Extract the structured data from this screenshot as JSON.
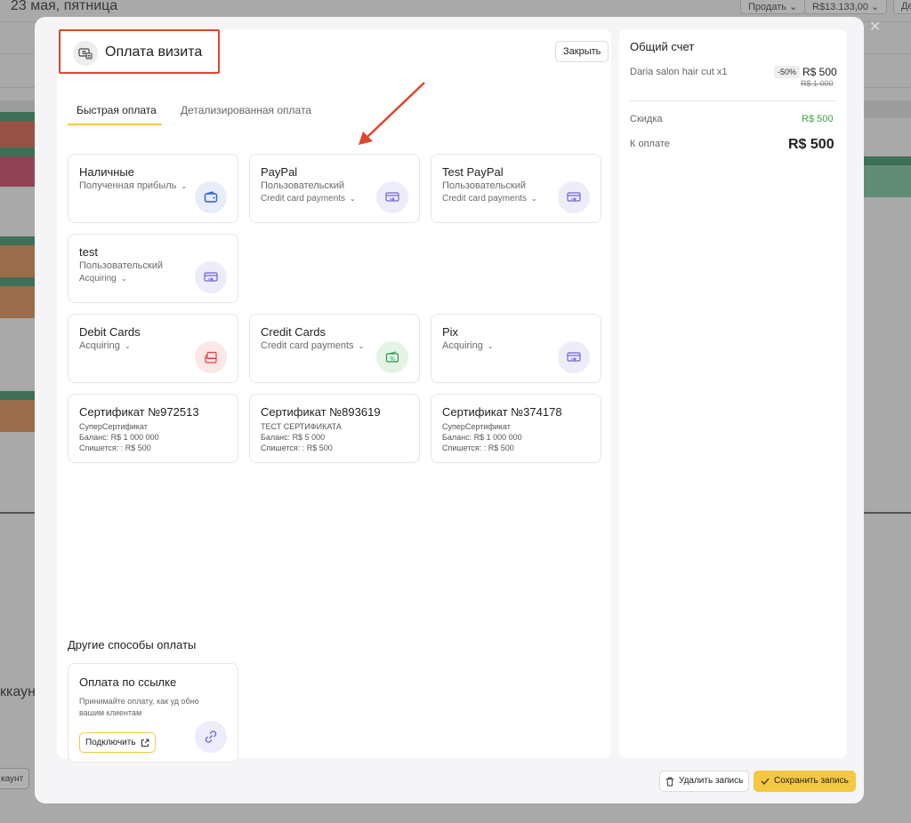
{
  "background": {
    "date": "23 мая, пятница",
    "sell_button": "Продать",
    "balance": "R$13.133,00",
    "right_btn": "Де",
    "left_account_text": "ккаун",
    "left_account_btn": "каунт"
  },
  "modal": {
    "title": "Оплата визита",
    "close_button": "Закрыть",
    "tabs": [
      "Быстрая оплата",
      "Детализированная оплата"
    ],
    "payment_methods": [
      {
        "title": "Наличные",
        "sub": "Полученная прибыль",
        "sub_dropdown": true,
        "sub2": "",
        "icon": "wallet-icon",
        "color": "blue"
      },
      {
        "title": "PayPal",
        "sub": "Пользовательский",
        "sub_dropdown": false,
        "sub2": "Credit card payments",
        "icon": "card-transfer-icon",
        "color": "purple"
      },
      {
        "title": "Test PayPal",
        "sub": "Пользовательский",
        "sub_dropdown": false,
        "sub2": "Credit card payments",
        "icon": "card-transfer-icon",
        "color": "purple"
      },
      {
        "title": "test",
        "sub": "Пользовательский",
        "sub_dropdown": false,
        "sub2": "Acquiring",
        "icon": "card-transfer-icon",
        "color": "purple"
      },
      {
        "title": "Debit Cards",
        "sub": "Acquiring",
        "sub_dropdown": true,
        "sub2": "",
        "icon": "cards-stack-icon",
        "color": "red"
      },
      {
        "title": "Credit Cards",
        "sub": "Credit card payments",
        "sub_dropdown": true,
        "sub2": "",
        "icon": "percent-card-icon",
        "color": "green"
      },
      {
        "title": "Pix",
        "sub": "Acquiring",
        "sub_dropdown": true,
        "sub2": "",
        "icon": "card-transfer-icon",
        "color": "purple"
      }
    ],
    "certificates": [
      {
        "title": "Сертификат №972513",
        "type": "СуперСертификат",
        "balance": "Баланс: R$ 1 000 000",
        "charge": "Спишется: : R$ 500"
      },
      {
        "title": "Сертификат №893619",
        "type": "ТЕСТ СЕРТИФИКАТА",
        "balance": "Баланс: R$ 5 000",
        "charge": "Спишется: : R$ 500"
      },
      {
        "title": "Сертификат №374178",
        "type": "СуперСертификат",
        "balance": "Баланс: R$ 1 000 000",
        "charge": "Спишется: : R$ 500"
      }
    ],
    "other_methods_title": "Другие способы оплаты",
    "link_payment": {
      "title": "Оплата по ссылке",
      "description": "Принимайте оплату, как уд обно вашим клиентам",
      "connect_button": "Подключить"
    },
    "summary": {
      "title": "Общий счет",
      "item": "Daria salon hair cut  x1",
      "discount_badge": "-50%",
      "price": "R$ 500",
      "old_price": "R$ 1 000",
      "discount_label": "Скидка",
      "discount_value": "R$ 500",
      "total_label": "К оплате",
      "total_value": "R$ 500"
    },
    "delete_button": "Удалить запись",
    "save_button": "Сохранить запись"
  },
  "colors": {
    "accent": "#f5c842",
    "highlight": "#e0452d",
    "discount": "#3aa34a"
  }
}
